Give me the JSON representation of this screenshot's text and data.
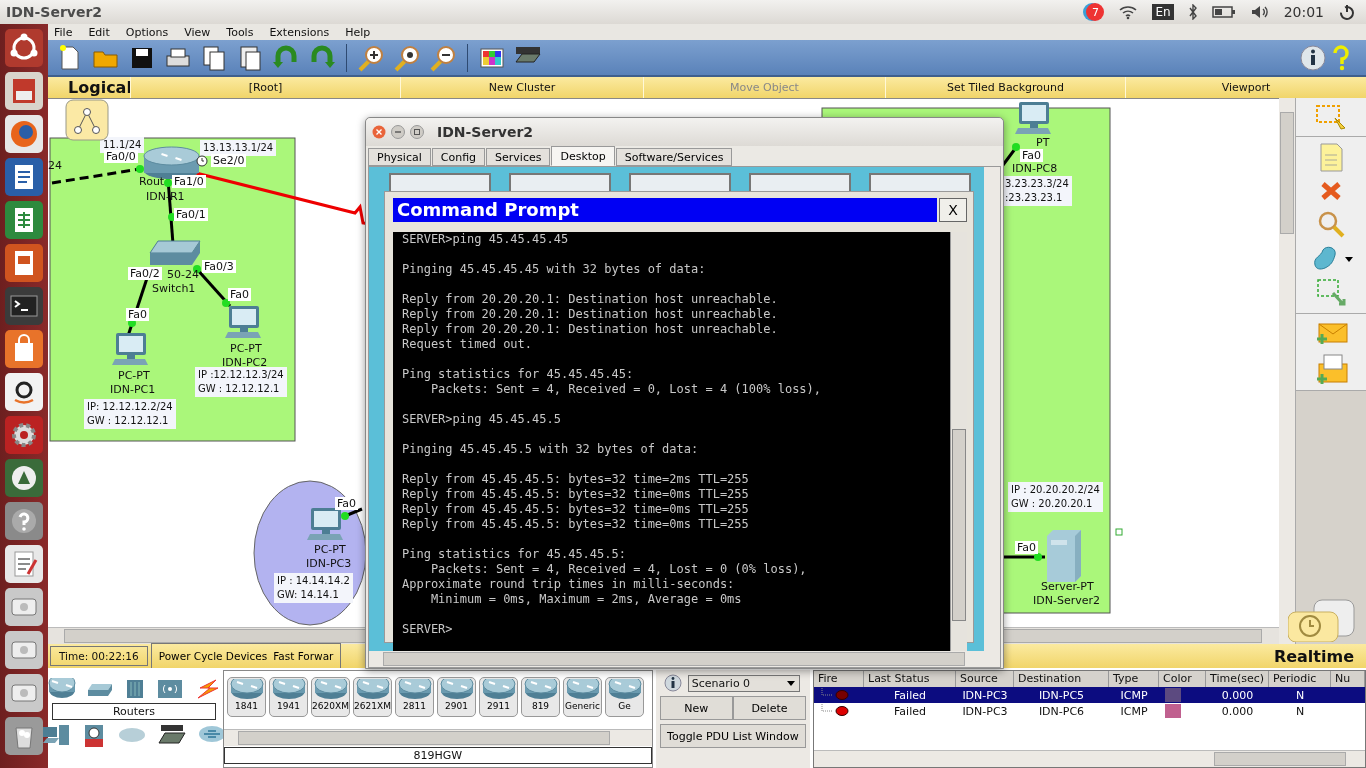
{
  "topbar": {
    "title": "IDN-Server2",
    "notifications": "7",
    "keyboard": "En",
    "clock": "20:01"
  },
  "menu": [
    "File",
    "Edit",
    "Options",
    "View",
    "Tools",
    "Extensions",
    "Help"
  ],
  "nav": {
    "view": "Logical",
    "items": [
      {
        "label": "[Root]",
        "disabled": false
      },
      {
        "label": "New Cluster",
        "disabled": false
      },
      {
        "label": "Move Object",
        "disabled": true
      },
      {
        "label": "Set Tiled Background",
        "disabled": false
      },
      {
        "label": "Viewport",
        "disabled": false
      }
    ]
  },
  "canvas": {
    "devices": [
      {
        "kind": "router"
      },
      {
        "kind": "switch"
      },
      {
        "kind": "pc"
      },
      {
        "kind": "pc"
      },
      {
        "kind": "pc"
      },
      {
        "kind": "pc"
      },
      {
        "kind": "server"
      }
    ],
    "labels": [
      {
        "kind": "address",
        "lines": [
          "11.1/24"
        ]
      },
      {
        "kind": "caption",
        "text": "24"
      },
      {
        "kind": "port",
        "text": "Fa0/0",
        "clock": false
      },
      {
        "kind": "address",
        "lines": [
          "13.13.13.1/24"
        ]
      },
      {
        "kind": "port",
        "text": "Se2/0",
        "clock": true
      },
      {
        "kind": "caption",
        "text": "Rout"
      },
      {
        "kind": "port",
        "text": "Fa1/0",
        "clock": false
      },
      {
        "kind": "caption",
        "text": "IDN-R1"
      },
      {
        "kind": "port",
        "text": "Fa0/1",
        "clock": false
      },
      {
        "kind": "port",
        "text": "Fa0/2",
        "clock": false
      },
      {
        "kind": "caption",
        "text": "50-24"
      },
      {
        "kind": "port",
        "text": "Fa0/3",
        "clock": false
      },
      {
        "kind": "caption",
        "text": "Switch1"
      },
      {
        "kind": "port",
        "text": "Fa0",
        "clock": false
      },
      {
        "kind": "port",
        "text": "Fa0",
        "clock": false
      },
      {
        "kind": "caption",
        "text": "PC-PT"
      },
      {
        "kind": "caption",
        "text": "IDN-PC1"
      },
      {
        "kind": "address",
        "lines": [
          "IP: 12.12.12.2/24",
          "GW : 12.12.12.1"
        ]
      },
      {
        "kind": "caption",
        "text": "PC-PT"
      },
      {
        "kind": "caption",
        "text": "IDN-PC2"
      },
      {
        "kind": "address",
        "lines": [
          "IP :12.12.12.3/24",
          "GW : 12.12.12.1"
        ]
      },
      {
        "kind": "port",
        "text": "Fa0",
        "clock": false
      },
      {
        "kind": "caption",
        "text": "PC-PT"
      },
      {
        "kind": "caption",
        "text": "IDN-PC3"
      },
      {
        "kind": "address",
        "lines": [
          "IP : 14.14.14.2",
          "GW: 14.14.1"
        ]
      },
      {
        "kind": "caption",
        "text": "PT"
      },
      {
        "kind": "port",
        "text": "Fa0",
        "clock": false
      },
      {
        "kind": "caption",
        "text": "IDN-PC8"
      },
      {
        "kind": "address",
        "lines": [
          "3.23.23.3/24",
          ":23.23.23.1"
        ]
      },
      {
        "kind": "address",
        "lines": [
          "IP : 20.20.20.2/24",
          "GW : 20.20.20.1"
        ]
      },
      {
        "kind": "port",
        "text": "Fa0",
        "clock": false
      },
      {
        "kind": "caption",
        "text": "Server-PT"
      },
      {
        "kind": "caption",
        "text": "IDN-Server2"
      }
    ]
  },
  "dialog": {
    "title": "IDN-Server2",
    "tabs": [
      {
        "label": "Physical",
        "selected": false
      },
      {
        "label": "Config",
        "selected": false
      },
      {
        "label": "Services",
        "selected": false
      },
      {
        "label": "Desktop",
        "selected": true
      },
      {
        "label": "Software/Services",
        "selected": false
      }
    ],
    "prompt": {
      "title": "Command Prompt",
      "close": "X",
      "blocks": [
        [
          "SERVER>ping 45.45.45.45"
        ],
        [
          "Pinging 45.45.45.45 with 32 bytes of data:"
        ],
        [
          "Reply from 20.20.20.1: Destination host unreachable.",
          "Reply from 20.20.20.1: Destination host unreachable.",
          "Reply from 20.20.20.1: Destination host unreachable.",
          "Request timed out."
        ],
        [
          "Ping statistics for 45.45.45.45:",
          "    Packets: Sent = 4, Received = 0, Lost = 4 (100% loss),"
        ],
        [
          "SERVER>ping 45.45.45.5"
        ],
        [
          "Pinging 45.45.45.5 with 32 bytes of data:"
        ],
        [
          "Reply from 45.45.45.5: bytes=32 time=2ms TTL=255",
          "Reply from 45.45.45.5: bytes=32 time=0ms TTL=255",
          "Reply from 45.45.45.5: bytes=32 time=0ms TTL=255",
          "Reply from 45.45.45.5: bytes=32 time=0ms TTL=255"
        ],
        [
          "Ping statistics for 45.45.45.5:",
          "    Packets: Sent = 4, Received = 4, Lost = 0 (0% loss),",
          "Approximate round trip times in milli-seconds:",
          "    Minimum = 0ms, Maximum = 2ms, Average = 0ms"
        ],
        [
          "SERVER>"
        ]
      ]
    }
  },
  "sim_bar": {
    "time": "Time: 00:22:16",
    "buttons": [
      "Power Cycle Devices",
      "Fast Forwar"
    ],
    "mode": "Realtime"
  },
  "device_panel": {
    "category": "Routers",
    "models": [
      "1841",
      "1941",
      "2620XM",
      "2621XM",
      "2811",
      "2901",
      "2911",
      "819",
      "Generic",
      "Ge"
    ],
    "selected_model": "819HGW"
  },
  "scenario": {
    "name": "Scenario 0",
    "buttons": [
      "New",
      "Delete"
    ],
    "toggle": "Toggle PDU List Window"
  },
  "pdu_table": {
    "columns": [
      "Fire",
      "Last Status",
      "Source",
      "Destination",
      "Type",
      "Color",
      "Time(sec)",
      "Periodic",
      "Nu"
    ],
    "rows": [
      {
        "selected": true,
        "last_status": "Failed",
        "source": "IDN-PC3",
        "destination": "IDN-PC5",
        "type": "ICMP",
        "color": "#5c4a80",
        "time": "0.000",
        "periodic": "N"
      },
      {
        "selected": false,
        "last_status": "Failed",
        "source": "IDN-PC3",
        "destination": "IDN-PC6",
        "type": "ICMP",
        "color": "#c0608f",
        "time": "0.000",
        "periodic": "N"
      }
    ]
  }
}
